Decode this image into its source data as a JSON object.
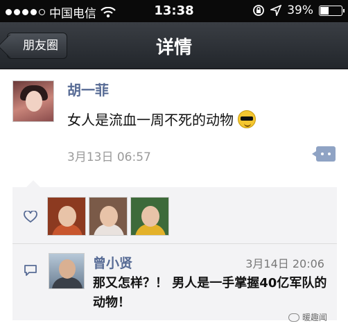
{
  "status_bar": {
    "carrier": "中国电信",
    "time": "13:38",
    "battery": "39%",
    "battery_level": 0.39,
    "icons": [
      "signal-dots",
      "wifi-icon",
      "rotation-lock-icon",
      "location-arrow-icon",
      "battery-icon"
    ]
  },
  "nav": {
    "back_label": "朋友圈",
    "title": "详情"
  },
  "post": {
    "author": "胡一菲",
    "content": "女人是流血一周不死的动物",
    "emoji": "sunglasses-smile-emoji",
    "time": "3月13日 06:57"
  },
  "likes": {
    "icon": "heart-icon",
    "users": [
      {
        "name": "liker-1",
        "color": "#c8562e"
      },
      {
        "name": "liker-2",
        "color": "#e9e2de"
      },
      {
        "name": "liker-3",
        "color": "#e3b12a"
      }
    ]
  },
  "comment": {
    "icon": "comment-bubble-icon",
    "author": "曾小贤",
    "time": "3月14日 20:06",
    "text": "那又怎样？！ 男人是一手掌握40亿军队的动物！"
  },
  "watermark": "暖趣闻",
  "colors": {
    "link_blue": "#576b95",
    "panel_bg": "#f3f3f5",
    "nav_dark": "#2c3036"
  }
}
